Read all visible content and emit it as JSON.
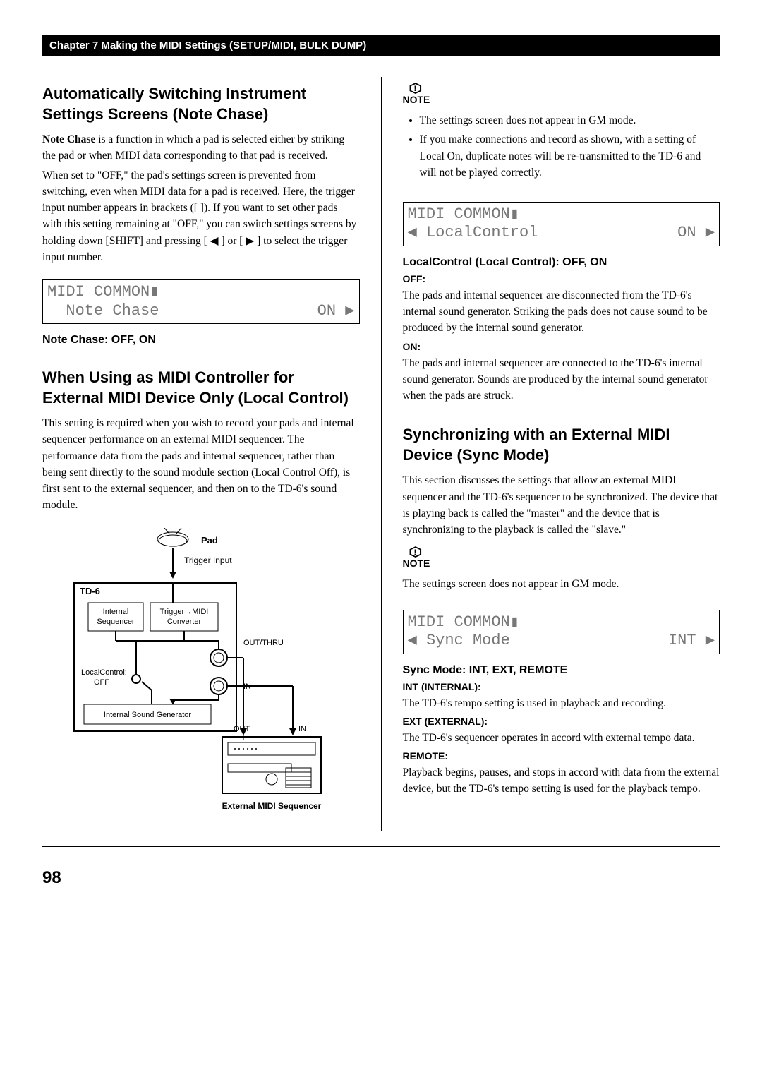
{
  "chapter_bar": "Chapter 7 Making the MIDI Settings (SETUP/MIDI, BULK DUMP)",
  "left": {
    "h1": "Automatically Switching Instrument Settings Screens (Note Chase)",
    "p1_lead": "Note Chase",
    "p1_rest": " is a function in which a pad is selected either by striking the pad or when MIDI data corresponding to that pad is received.",
    "p2": "When set to \"OFF,\" the pad's settings screen is prevented from switching, even when MIDI data for a pad is received. Here, the trigger input number appears in brackets ([ ]). If you want to set other pads with this setting remaining at \"OFF,\" you can switch settings screens by holding down [SHIFT] and pressing [ ◀ ] or [ ▶ ] to select the trigger input number.",
    "lcd1_line1": "MIDI COMMON▮",
    "lcd1_line2_left": "  Note Chase",
    "lcd1_line2_right": "ON ▶",
    "sub1": "Note Chase: OFF, ON",
    "h2": "When Using as MIDI Controller for External MIDI Device Only (Local Control)",
    "p3": "This setting is required when you wish to record your pads and internal sequencer performance on an external MIDI sequencer. The performance data from the pads and internal sequencer, rather than being sent directly to the sound module section (Local Control Off), is first sent to the external sequencer, and then on to the TD-6's sound module.",
    "diagram": {
      "pad": "Pad",
      "trigger_input": "Trigger Input",
      "td6": "TD-6",
      "internal_seq": "Internal\nSequencer",
      "trigger_conv": "Trigger→MIDI\nConverter",
      "out_thru": "OUT/THRU",
      "local_off": "LocalControl:\nOFF",
      "in": "IN",
      "out": "OUT",
      "in2": "IN",
      "isg": "Internal Sound Generator",
      "ext_seq": "External MIDI Sequencer"
    }
  },
  "right": {
    "note_label": "NOTE",
    "bullets": [
      "The settings screen does not appear in GM mode.",
      "If you make connections and record as shown, with a setting of Local On, duplicate notes will be re-transmitted to the TD-6 and will not be played correctly."
    ],
    "lcd2_line1": "MIDI COMMON▮",
    "lcd2_line2_left": "◀ LocalControl",
    "lcd2_line2_right": "ON ▶",
    "sub_lc": "LocalControl (Local Control): OFF, ON",
    "off_label": "OFF:",
    "off_text": "The pads and internal sequencer are disconnected from the TD-6's internal sound generator. Striking the pads does not cause sound to be produced by the internal sound generator.",
    "on_label": "ON:",
    "on_text": "The pads and internal sequencer are connected to the TD-6's internal sound generator. Sounds are produced by the internal sound generator when the pads are struck.",
    "h3": "Synchronizing with an External MIDI Device (Sync Mode)",
    "p4": "This section discusses the settings that allow an external MIDI sequencer and the TD-6's sequencer to be synchronized. The device that is playing back is called the \"master\" and the device that is synchronizing to the playback is called the \"slave.\"",
    "p5": "The settings screen does not appear in GM mode.",
    "lcd3_line1": "MIDI COMMON▮",
    "lcd3_line2_left": "◀ Sync Mode",
    "lcd3_line2_right": "INT ▶",
    "sub_sync": "Sync Mode: INT, EXT, REMOTE",
    "int_label": "INT (INTERNAL):",
    "int_text": "The TD-6's tempo setting is used in playback and recording.",
    "ext_label": "EXT (EXTERNAL):",
    "ext_text": "The TD-6's sequencer operates in accord with external tempo data.",
    "remote_label": "REMOTE:",
    "remote_text": "Playback begins, pauses, and stops in accord with data from the external device, but the TD-6's tempo setting is used for the playback tempo."
  },
  "page_number": "98"
}
